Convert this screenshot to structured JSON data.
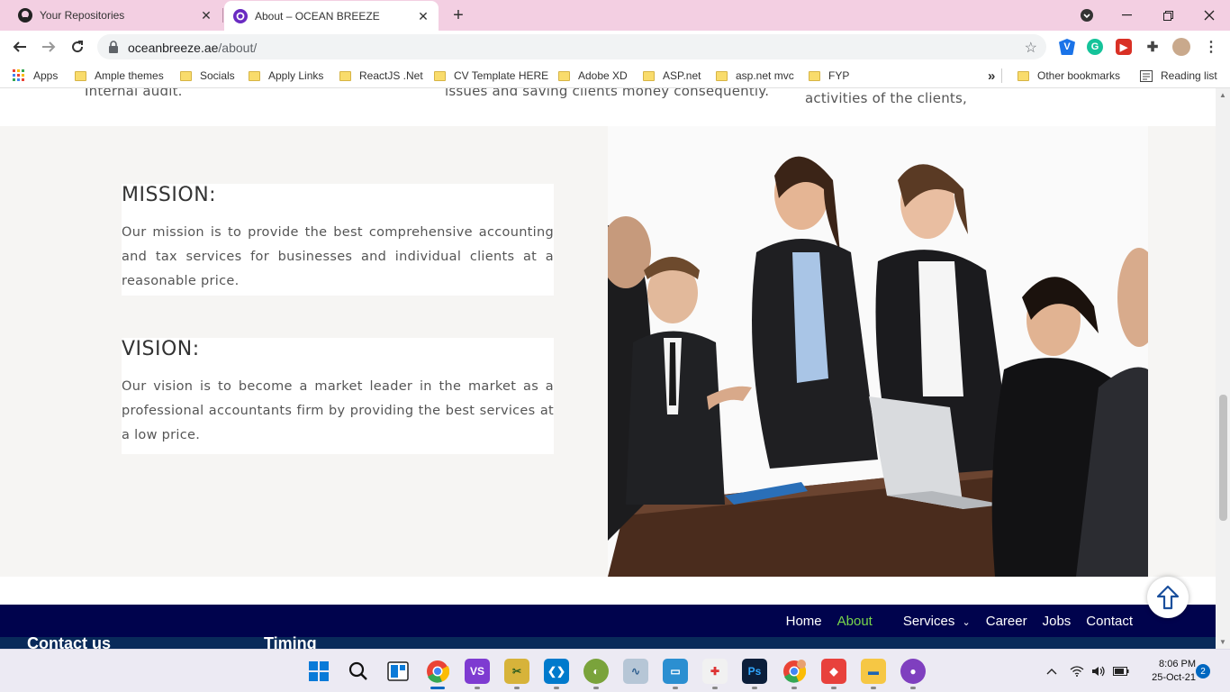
{
  "browser": {
    "tabs": [
      {
        "title": "Your Repositories",
        "icon": "github-icon"
      },
      {
        "title": "About – OCEAN BREEZE",
        "icon": "ocean-breeze-icon"
      }
    ],
    "url_domain": "oceanbreeze.ae",
    "url_path": "/about/",
    "bookmarks": [
      "Apps",
      "Ample themes",
      "Socials",
      "Apply Links",
      "ReactJS .Net",
      "CV Template HERE",
      "Adobe XD",
      "ASP.net",
      "asp.net mvc",
      "FYP",
      "Other bookmarks",
      "Reading list"
    ],
    "overflow_label": "»"
  },
  "page": {
    "cutoff_texts": [
      "Internal audit.",
      "issues and saving clients money consequently.",
      "activities of the clients,"
    ],
    "mission": {
      "heading": "MISSION:",
      "text": "Our mission is to provide the best comprehensive accounting and tax services for businesses and individual clients at a reasonable price."
    },
    "vision": {
      "heading": "VISION:",
      "text": "Our vision is to become a market leader in the market as a professional accountants firm by providing the best services at a low price."
    },
    "footer_nav": [
      "Home",
      "About",
      "Services",
      "Career",
      "Jobs",
      "Contact"
    ],
    "footer_nav_active": "About",
    "footer_headings": [
      "Contact us",
      "Timing"
    ],
    "accent_color": "#78d64b",
    "footer_color": "#00034d"
  },
  "taskbar": {
    "time": "8:06 PM",
    "date": "25-Oct-21",
    "notifications": "2",
    "apps": [
      "start",
      "search",
      "task-view",
      "chrome",
      "visual-studio",
      "tool",
      "vscode",
      "app",
      "monitor",
      "remote-desktop",
      "app2",
      "photoshop",
      "chrome-profile",
      "git",
      "file-explorer",
      "github-desktop"
    ]
  }
}
